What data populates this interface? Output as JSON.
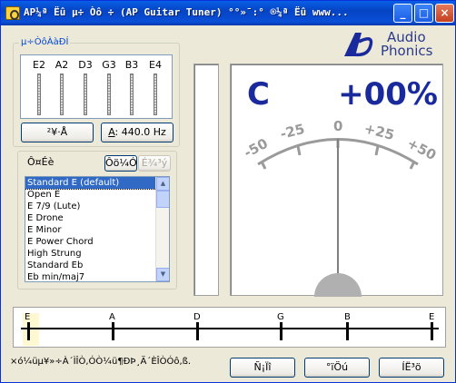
{
  "window": {
    "title": "AP¼ª Ëû µ÷ Òô ÷ (AP Guitar Tuner) °°»¯:° ®¼ª Ëû www...",
    "minimize_label": "_",
    "maximize_label": "□",
    "close_label": "×"
  },
  "logo": {
    "line1": "Audio",
    "line2": "Phonics"
  },
  "strings_group": {
    "label": "µ÷ÒôÀàÐÍ",
    "strings": [
      "E2",
      "A2",
      "D3",
      "G3",
      "B3",
      "E4"
    ]
  },
  "buttons": {
    "auto_label": "²¥·Å",
    "freq_prefix": "A",
    "freq_label": ": 440.0 Hz",
    "add_label": "Ôö¼Ó",
    "delete_label": "É¾³ý",
    "help_label": "Ñ¡Ïî",
    "about_label": "°ïÖú",
    "exit_label": "ÍË³ö"
  },
  "tuning_group": {
    "label": "Ô¤Éè",
    "items": [
      "Standard E (default)",
      "Open E",
      "E 7/9 (Lute)",
      "E Drone",
      "E Minor",
      "E Power Chord",
      "High Strung",
      "Standard Eb",
      "Eb min/maj7"
    ],
    "selected_index": 0
  },
  "meter": {
    "note": "C",
    "cents": "+00%",
    "scale_labels": [
      "-50",
      "-25",
      "0",
      "+25",
      "+50"
    ]
  },
  "string_track": {
    "labels": [
      "E",
      "A",
      "D",
      "G",
      "B",
      "E"
    ],
    "active_index": 0
  },
  "status": {
    "text": "×ó¼üµ¥»÷À´ÌÎÒ,ÓÒ¼ü¶ÐÞ¸Ä´ÈÎÒÓô,ß."
  },
  "colors": {
    "title_blue": "#0a5fe6",
    "meter_blue": "#1a2a9c",
    "selection": "#316ac5",
    "scale_gray": "#9a9a9a"
  }
}
